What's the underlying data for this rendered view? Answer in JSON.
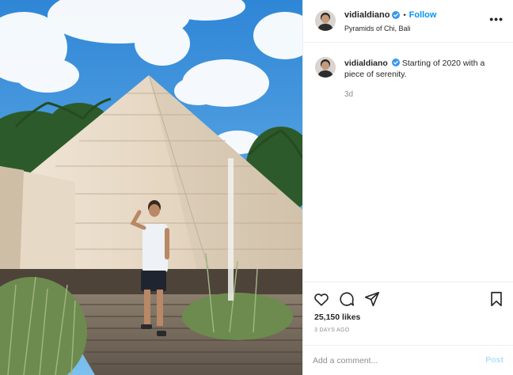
{
  "post": {
    "username": "vidialdiano",
    "verified": true,
    "follow_label": "Follow",
    "dot": "•",
    "location": "Pyramids of Chi, Bali",
    "more_icon": "more-options-icon",
    "more_label": "•••"
  },
  "caption": {
    "username": "vidialdiano",
    "text": "Starting of 2020 with a piece of serenity.",
    "time": "3d"
  },
  "actions": {
    "icons": [
      "heart-icon",
      "comment-icon",
      "share-icon",
      "bookmark-icon"
    ],
    "likes": "25,150 likes",
    "ago": "3 DAYS AGO"
  },
  "comment_box": {
    "placeholder": "Add a comment...",
    "post_label": "Post"
  },
  "colors": {
    "accent": "#0095f6",
    "post_disabled": "#b2dffc",
    "muted": "#8e8e8e",
    "sky": "#3f8fd4"
  }
}
